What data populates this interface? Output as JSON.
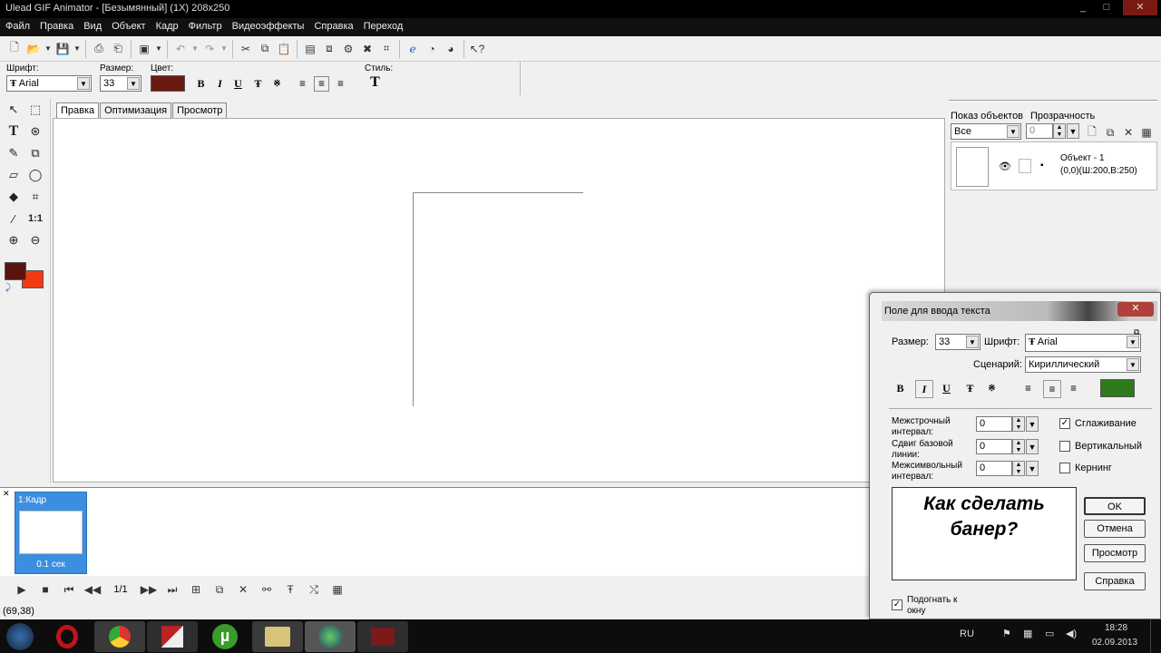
{
  "window": {
    "title": "Ulead GIF Animator - [Безымянный] (1X) 208x250",
    "minimize": "_",
    "maximize": "□",
    "close": "✕"
  },
  "menu": [
    "Файл",
    "Правка",
    "Вид",
    "Объект",
    "Кадр",
    "Фильтр",
    "Видеоэффекты",
    "Справка",
    "Переход"
  ],
  "format_bar": {
    "font_label": "Шрифт:",
    "font_value": "Arial",
    "size_label": "Размер:",
    "size_value": "33",
    "color_label": "Цвет:",
    "color_value": "#6b1a12",
    "style_label": "Стиль:",
    "bold": "B",
    "italic": "I",
    "underline": "U"
  },
  "tabs": [
    "Правка",
    "Оптимизация",
    "Просмотр"
  ],
  "colors": {
    "foreground": "#5a140e",
    "background": "#f03a14",
    "accent": "#3c8ee0"
  },
  "objects_panel": {
    "show_label": "Показ объектов",
    "show_value": "Все",
    "opacity_label": "Прозрачность",
    "opacity_value": "0",
    "object_name": "Объект - 1",
    "object_dims": "(0,0)(Ш:200,В:250)"
  },
  "frames": {
    "frame_label": "1:Кадр",
    "frame_delay": "0.1 сек",
    "counter": "1/1"
  },
  "status": {
    "coords": "(69,38)"
  },
  "dialog": {
    "title": "Поле для ввода текста",
    "size_label": "Размер:",
    "size_value": "33",
    "font_label": "Шрифт:",
    "font_value": "Arial",
    "script_label": "Сценарий:",
    "script_value": "Кириллический",
    "text_color": "#2e7a1c",
    "line_spacing_label": "Межстрочный интервал:",
    "line_spacing_value": "0",
    "baseline_label": "Сдвиг базовой линии:",
    "baseline_value": "0",
    "char_spacing_label": "Межсимвольный интервал:",
    "char_spacing_value": "0",
    "antialias_label": "Сглаживание",
    "vertical_label": "Вертикальный",
    "kerning_label": "Кернинг",
    "text_line1": "Как сделать",
    "text_line2": "банер?",
    "ok": "OK",
    "cancel": "Отмена",
    "preview": "Просмотр",
    "help": "Справка",
    "fit_label": "Подогнать к окну"
  },
  "taskbar": {
    "lang": "RU",
    "time": "18:28",
    "date": "02.09.2013"
  }
}
